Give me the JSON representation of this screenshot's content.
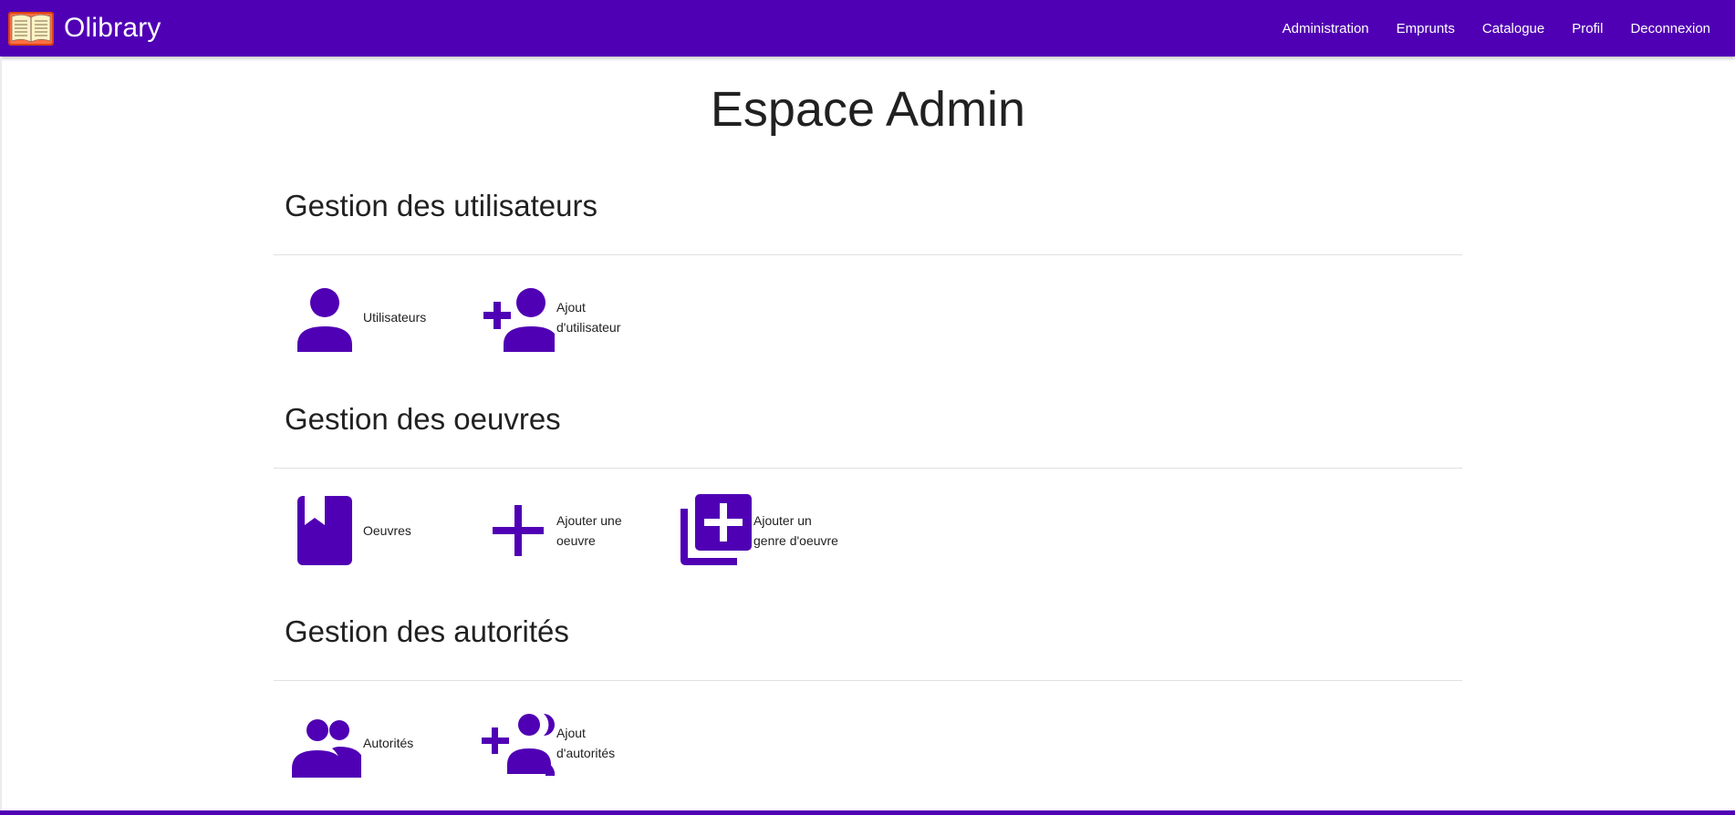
{
  "app": {
    "name": "Olibrary"
  },
  "nav": {
    "items": [
      {
        "label": "Administration"
      },
      {
        "label": "Emprunts"
      },
      {
        "label": "Catalogue"
      },
      {
        "label": "Profil"
      },
      {
        "label": "Deconnexion"
      }
    ]
  },
  "page": {
    "title": "Espace Admin"
  },
  "sections": [
    {
      "title": "Gestion des utilisateurs",
      "tiles": [
        {
          "label": "Utilisateurs",
          "icon": "person-icon"
        },
        {
          "label_line1": "Ajout",
          "label_line2": "d'utilisateur",
          "icon": "person-add-icon"
        }
      ]
    },
    {
      "title": "Gestion des oeuvres",
      "tiles": [
        {
          "label": "Oeuvres",
          "icon": "book-icon"
        },
        {
          "label_line1": "Ajouter une",
          "label_line2": "oeuvre",
          "icon": "plus-icon"
        },
        {
          "label_line1": "Ajouter un",
          "label_line2": "genre d'oeuvre",
          "icon": "library-add-icon"
        }
      ]
    },
    {
      "title": "Gestion des autorités",
      "tiles": [
        {
          "label": "Autorités",
          "icon": "group-icon"
        },
        {
          "label_line1": "Ajout",
          "label_line2": "d'autorités",
          "icon": "group-add-icon"
        }
      ]
    }
  ],
  "colors": {
    "primary": "#5000b4",
    "icon": "#5000b4",
    "text": "#212121",
    "divider": "#e0e0e0"
  }
}
